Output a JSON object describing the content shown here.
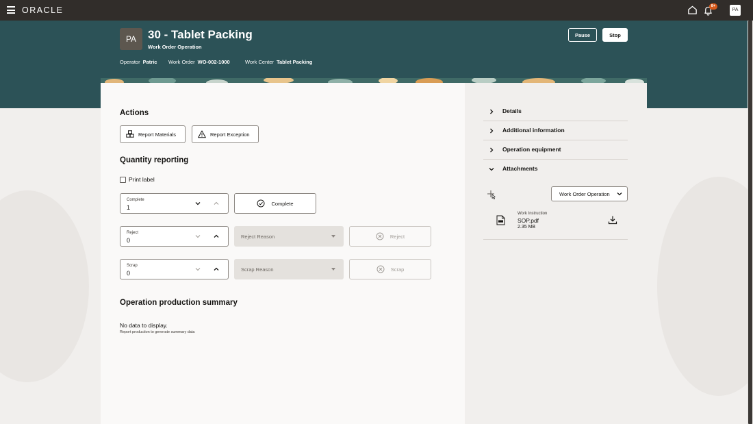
{
  "topbar": {
    "logo": "ORACLE",
    "notification_count": "8+",
    "user_initials": "PA"
  },
  "header": {
    "avatar_initials": "PA",
    "title": "30 - Tablet Packing",
    "subtitle": "Work Order Operation",
    "operator_label": "Operator",
    "operator_value": "Patric",
    "work_order_label": "Work Order",
    "work_order_value": "WO-002-1000",
    "work_center_label": "Work Center",
    "work_center_value": "Tablet Packing",
    "pause_label": "Pause",
    "stop_label": "Stop"
  },
  "actions": {
    "heading": "Actions",
    "report_materials": "Report Materials",
    "report_exception": "Report Exception"
  },
  "quantity": {
    "heading": "Quantity reporting",
    "print_label": "Print label",
    "complete_field_label": "Complete",
    "complete_value": "1",
    "complete_button": "Complete",
    "reject_field_label": "Reject",
    "reject_value": "0",
    "reject_reason_placeholder": "Reject Reason",
    "reject_button": "Reject",
    "scrap_field_label": "Scrap",
    "scrap_value": "0",
    "scrap_reason_placeholder": "Scrap Reason",
    "scrap_button": "Scrap"
  },
  "summary": {
    "heading": "Operation production summary",
    "empty_title": "No data to display.",
    "empty_subtitle": "Report production to generate summary data"
  },
  "sidebar": {
    "sections": [
      {
        "label": "Details",
        "expanded": false
      },
      {
        "label": "Additional information",
        "expanded": false
      },
      {
        "label": "Operation equipment",
        "expanded": false
      },
      {
        "label": "Attachments",
        "expanded": true
      }
    ],
    "attachment_filter": "Work Order Operation",
    "attachments": [
      {
        "type": "Work Instruction",
        "name": "SOP.pdf",
        "size": "2.35 MB",
        "icon": "pdf-file-icon"
      }
    ]
  },
  "colors": {
    "topbar": "#312d2a",
    "header": "#2c5257",
    "badge": "#d75a1b"
  }
}
